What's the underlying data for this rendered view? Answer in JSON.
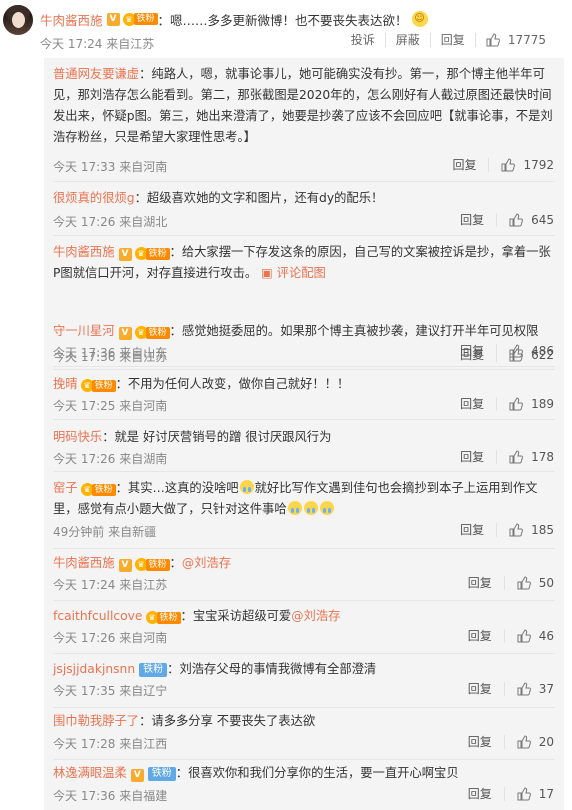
{
  "main_comment": {
    "username": "牛肉酱西施",
    "badge_v": "V",
    "fan_badge": "铁粉",
    "text": "：嗯……多多更新微博！也不要丧失表达欲！",
    "emoji": "☺",
    "meta": "今天 17:24 来自江苏",
    "actions": {
      "report": "投诉",
      "block": "屏蔽",
      "reply": "回复",
      "likes": "17775"
    }
  },
  "replies": [
    {
      "username": "普通网友要谦虚",
      "text": "：纯路人，嗯，就事论事儿，她可能确实没有抄。第一，那个博主他半年可见，那刘浩存怎么能看到。第二，那张截图是2020年的，怎么刚好有人截过原图还最快时间发出来，怀疑p图。第三，她出来澄清了，她要是抄袭了应该不会回应吧【就事论事，不是刘浩存粉丝，只是希望大家理性思考。】",
      "meta": "今天 17:33 来自河南",
      "reply_label": "回复",
      "likes": "1792"
    },
    {
      "username": "很烦真的很烦g",
      "text": "：超级喜欢她的文字和图片，还有dy的配乐！",
      "meta": "今天 17:26 来自湖北",
      "reply_label": "回复",
      "likes": "645"
    },
    {
      "username": "牛肉酱西施",
      "badge_v": "V",
      "fan_badge": "铁粉",
      "text": "：给大家摆一下存发这条的原因，自己写的文案被控诉是抄，拿着一张P图就信口开河，对存直接进行攻击。",
      "pic_link": "评论配图",
      "meta": "今天 17:36 来自江苏",
      "reply_label": "回复",
      "likes": "622"
    },
    {
      "username": "守一川星河",
      "badge_v": "V",
      "fan_badge": "铁粉",
      "text": "：感觉她挺委屈的。如果那个博主真被抄袭，建议打开半年可见权限",
      "meta": "今天 17:36 来自山东",
      "reply_label": "回复",
      "likes": "486"
    },
    {
      "username": "挽晴",
      "fan_badge": "铁粉",
      "text": "：不用为任何人改变，做你自己就好！！！",
      "meta": "今天 17:25 来自河南",
      "reply_label": "回复",
      "likes": "189"
    },
    {
      "username": "明码快乐",
      "text": "：就是 好讨厌营销号的蹭 很讨厌跟风行为",
      "meta": "今天 17:26 来自湖南",
      "reply_label": "回复",
      "likes": "178"
    },
    {
      "username": "窑子",
      "fan_badge": "铁粉",
      "text_a": "：其实…这真的没啥吧",
      "text_b": "就好比写作文遇到佳句也会摘抄到本子上运用到作文里，感觉有点小题大做了，只针对这件事哈",
      "meta": "49分钟前 来自新疆",
      "reply_label": "回复",
      "likes": "185"
    },
    {
      "username": "牛肉酱西施",
      "badge_v": "V",
      "fan_badge": "铁粉",
      "text": "：",
      "mention": "@刘浩存",
      "meta": "今天 17:24 来自江苏",
      "reply_label": "回复",
      "likes": "50"
    },
    {
      "username": "fcaithfcullcove",
      "fan_badge": "铁粉",
      "text": "：宝宝采访超级可爱",
      "mention": "@刘浩存",
      "meta": "今天 17:26 来自河南",
      "reply_label": "回复",
      "likes": "46"
    },
    {
      "username": "jsjsjjdakjnsnn",
      "tie_badge": "铁粉",
      "text": "：刘浩存父母的事情我微博有全部澄清",
      "meta": "今天 17:35 来自辽宁",
      "reply_label": "回复",
      "likes": "37"
    },
    {
      "username": "围巾勒我脖子了",
      "text": "：请多多分享 不要丧失了表达欲",
      "meta": "今天 17:28 来自江西",
      "reply_label": "回复",
      "likes": "20"
    },
    {
      "username": "林逸满眼温柔",
      "badge_v": "V",
      "tie_badge": "铁粉",
      "text": "：很喜欢你和我们分享你的生活，要一直开心啊宝贝",
      "meta": "今天 17:36 来自福建",
      "reply_label": "回复",
      "likes": "17"
    }
  ]
}
